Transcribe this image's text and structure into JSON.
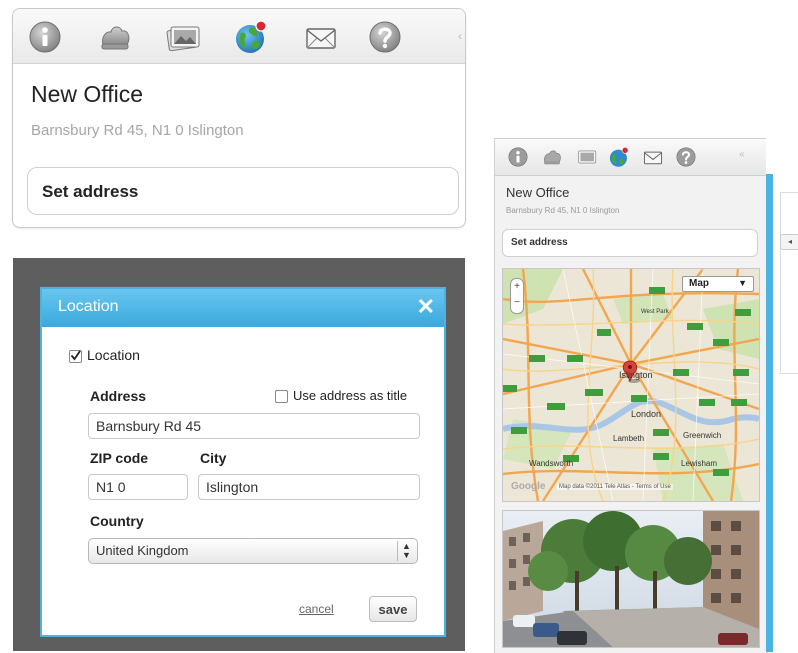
{
  "toolbar_icons": [
    "info-icon",
    "cloud-icon",
    "photo-icon",
    "globe-icon",
    "mail-icon",
    "help-icon"
  ],
  "card_large": {
    "title": "New Office",
    "subtitle": "Barnsbury Rd 45, N1 0 Islington",
    "set_address": "Set address"
  },
  "dialog": {
    "title": "Location",
    "close": "✕",
    "location_label": "Location",
    "location_checked": true,
    "address_label": "Address",
    "use_as_title_label": "Use address as title",
    "use_as_title_checked": false,
    "address_value": "Barnsbury Rd 45",
    "zip_label": "ZIP code",
    "city_label": "City",
    "zip_value": "N1 0",
    "city_value": "Islington",
    "country_label": "Country",
    "country_value": "United Kingdom",
    "cancel": "cancel",
    "save": "save"
  },
  "card_small": {
    "title": "New Office",
    "subtitle": "Barnsbury Rd 45, N1 0 Islington",
    "set_address": "Set address"
  },
  "map": {
    "type_button": "Map",
    "zoom_in": "+",
    "zoom_out": "−",
    "labels": [
      "Islington",
      "London",
      "Lambeth",
      "Greenwich",
      "Wandsworth",
      "Lewisham",
      "West Park"
    ],
    "attribution": "Map data ©2011 Tele Atlas - Terms of Use",
    "google": "Google"
  },
  "colors": {
    "dialog_header": "#3aa9dd",
    "accent_strip": "#4cb3e0",
    "notification_dot": "#d9282f"
  }
}
